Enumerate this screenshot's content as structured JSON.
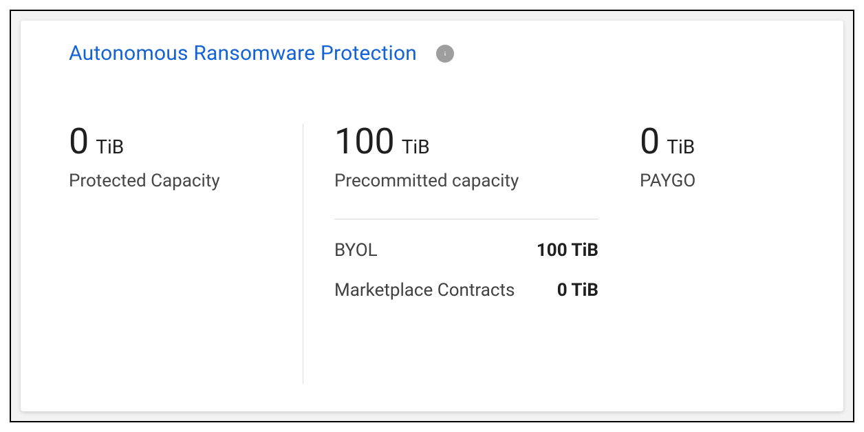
{
  "header": {
    "title": "Autonomous Ransomware Protection"
  },
  "metrics": {
    "protected": {
      "value": "0",
      "unit": "TiB",
      "label": "Protected Capacity"
    },
    "precommitted": {
      "value": "100",
      "unit": "TiB",
      "label": "Precommitted capacity",
      "breakdown": {
        "byol": {
          "label": "BYOL",
          "value": "100 TiB"
        },
        "marketplace": {
          "label": "Marketplace Contracts",
          "value": "0 TiB"
        }
      }
    },
    "paygo": {
      "value": "0",
      "unit": "TiB",
      "label": "PAYGO"
    }
  }
}
